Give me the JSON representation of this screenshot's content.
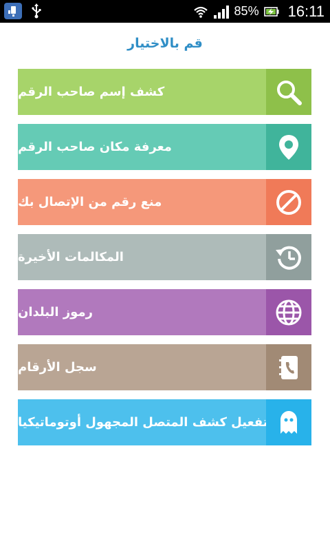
{
  "status_bar": {
    "battery_percent": "85%",
    "time": "16:11"
  },
  "page": {
    "title": "قم بالاختيار"
  },
  "menu": {
    "items": [
      {
        "label": "كشف إسم صاحب الرقم",
        "icon": "search-icon",
        "color": "#a7d46a",
        "icon_bg": "#8ec04a"
      },
      {
        "label": "معرفة مكان صاحب الرقم",
        "icon": "location-pin-icon",
        "color": "#65cbb5",
        "icon_bg": "#40b49b"
      },
      {
        "label": "منع رقم من الإتصال بك",
        "icon": "block-icon",
        "color": "#f5987a",
        "icon_bg": "#f07a58"
      },
      {
        "label": "المكالمات الأخيرة",
        "icon": "history-icon",
        "color": "#aebbb9",
        "icon_bg": "#909f9d"
      },
      {
        "label": "رموز البلدان",
        "icon": "globe-icon",
        "color": "#b179bd",
        "icon_bg": "#9b56a9"
      },
      {
        "label": "سجل الأرقام",
        "icon": "phonebook-icon",
        "color": "#b9a594",
        "icon_bg": "#a18a75"
      },
      {
        "label": "تفعيل كشف المتصل المجهول أوتوماتيكيا",
        "icon": "ghost-icon",
        "color": "#4dc0ed",
        "icon_bg": "#28b2ea"
      }
    ]
  }
}
